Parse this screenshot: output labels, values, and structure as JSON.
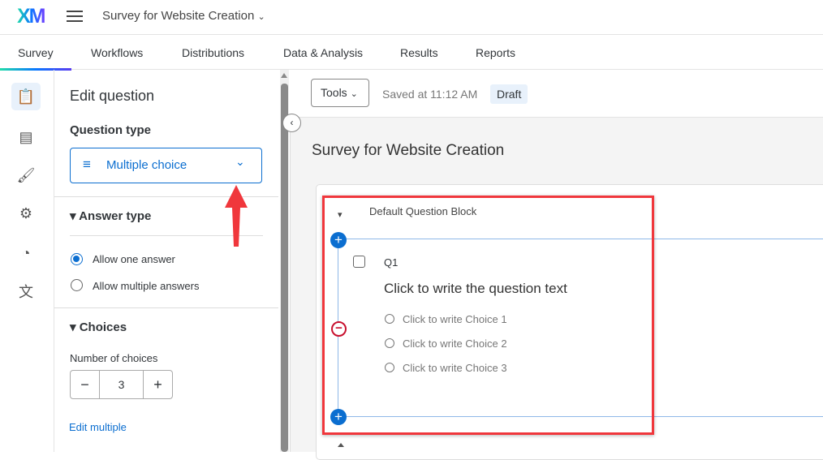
{
  "header": {
    "logo": "XM",
    "title": "Survey for Website Creation"
  },
  "tabs": [
    {
      "label": "Survey",
      "active": true
    },
    {
      "label": "Workflows"
    },
    {
      "label": "Distributions"
    },
    {
      "label": "Data & Analysis"
    },
    {
      "label": "Results"
    },
    {
      "label": "Reports"
    }
  ],
  "rail": [
    "survey-icon",
    "blocks-icon",
    "look-and-feel-icon",
    "survey-options-icon",
    "dashboard-icon",
    "translate-icon"
  ],
  "panel": {
    "heading": "Edit question",
    "question_type_label": "Question type",
    "question_type_value": "Multiple choice",
    "answer_type_label": "Answer type",
    "answer_options": [
      {
        "label": "Allow one answer",
        "selected": true
      },
      {
        "label": "Allow multiple answers",
        "selected": false
      }
    ],
    "choices_label": "Choices",
    "num_choices_label": "Number of choices",
    "num_choices": "3",
    "edit_multiple": "Edit multiple"
  },
  "toolbar": {
    "tools": "Tools",
    "saved": "Saved at 11:12 AM",
    "status": "Draft"
  },
  "survey": {
    "title": "Survey for Website Creation",
    "block_name": "Default Question Block",
    "question_id": "Q1",
    "question_text": "Click to write the question text",
    "choices": [
      "Click to write Choice 1",
      "Click to write Choice 2",
      "Click to write Choice 3"
    ]
  },
  "colors": {
    "accent": "#0b6ed0",
    "annotation": "#f0373c"
  }
}
